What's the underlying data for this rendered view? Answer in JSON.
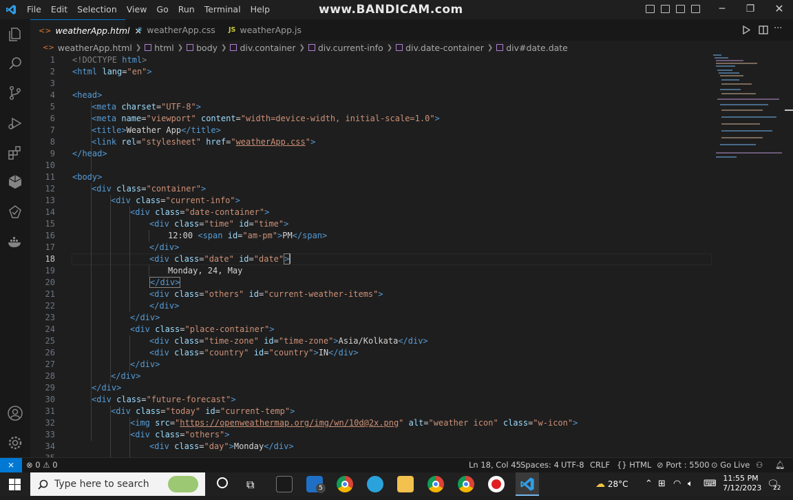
{
  "menu": [
    "File",
    "Edit",
    "Selection",
    "View",
    "Go",
    "Run",
    "Terminal",
    "Help"
  ],
  "watermark": "www.BANDICAM.com",
  "tabs": [
    {
      "icon": "<>",
      "label": "weatherApp.html",
      "close": "×"
    },
    {
      "icon": "#",
      "label": "weatherApp.css"
    },
    {
      "icon": "JS",
      "label": "weatherApp.js"
    }
  ],
  "breadcrumb": [
    "weatherApp.html",
    "html",
    "body",
    "div.container",
    "div.current-info",
    "div.date-container",
    "div#date.date"
  ],
  "line_numbers": [
    "1",
    "2",
    "3",
    "4",
    "5",
    "6",
    "7",
    "8",
    "9",
    "10",
    "11",
    "12",
    "13",
    "14",
    "15",
    "16",
    "17",
    "18",
    "19",
    "20",
    "21",
    "22",
    "23",
    "24",
    "25",
    "26",
    "27",
    "28",
    "29",
    "30",
    "31",
    "32",
    "33",
    "34",
    "35"
  ],
  "code_text": {
    "l1a": "<!DOCTYPE ",
    "l1b": "html",
    "l1c": ">",
    "l2a": "<html ",
    "l2b": "lang",
    "l2c": "=",
    "l2d": "\"en\"",
    "l2e": ">",
    "l4": "<head>",
    "l5a": "<meta ",
    "l5b": "charset",
    "l5c": "=",
    "l5d": "\"UTF-8\"",
    "l5e": ">",
    "l6a": "<meta ",
    "l6b": "name",
    "l6c": "=",
    "l6d": "\"viewport\"",
    "l6e": " content",
    "l6f": "=",
    "l6g": "\"width=device-width, initial-scale=1.0\"",
    "l6h": ">",
    "l7a": "<title>",
    "l7b": "Weather App",
    "l7c": "</title>",
    "l8a": "<link ",
    "l8b": "rel",
    "l8c": "=",
    "l8d": "\"stylesheet\"",
    "l8e": " href",
    "l8f": "=",
    "l8g": "\"",
    "l8h": "weatherApp.css",
    "l8i": "\"",
    "l8j": ">",
    "l9": "</head>",
    "l11": "<body>",
    "l12a": "<div ",
    "l12b": "class",
    "l12c": "=",
    "l12d": "\"container\"",
    "l12e": ">",
    "l13a": "<div ",
    "l13b": "class",
    "l13c": "=",
    "l13d": "\"current-info\"",
    "l13e": ">",
    "l14a": "<div ",
    "l14b": "class",
    "l14c": "=",
    "l14d": "\"date-container\"",
    "l14e": ">",
    "l15a": "<div ",
    "l15b": "class",
    "l15c": "=",
    "l15d": "\"time\"",
    "l15e": " id",
    "l15f": "=",
    "l15g": "\"time\"",
    "l15h": ">",
    "l16a": "12:00 ",
    "l16b": "<span ",
    "l16c": "id",
    "l16d": "=",
    "l16e": "\"am-pm\"",
    "l16f": ">",
    "l16g": "PM",
    "l16h": "</span>",
    "l17": "</div>",
    "l18a": "<div ",
    "l18b": "class",
    "l18c": "=",
    "l18d": "\"date\"",
    "l18e": " id",
    "l18f": "=",
    "l18g": "\"date\"",
    "l18h": ">",
    "l19": "Monday, 24, May",
    "l20": "</div>",
    "l21a": "<div ",
    "l21b": "class",
    "l21c": "=",
    "l21d": "\"others\"",
    "l21e": " id",
    "l21f": "=",
    "l21g": "\"current-weather-items\"",
    "l21h": ">",
    "l22": "</div>",
    "l23": "</div>",
    "l24a": "<div ",
    "l24b": "class",
    "l24c": "=",
    "l24d": "\"place-container\"",
    "l24e": ">",
    "l25a": "<div ",
    "l25b": "class",
    "l25c": "=",
    "l25d": "\"time-zone\"",
    "l25e": " id",
    "l25f": "=",
    "l25g": "\"time-zone\"",
    "l25h": ">",
    "l25i": "Asia/Kolkata",
    "l25j": "</div>",
    "l26a": "<div ",
    "l26b": "class",
    "l26c": "=",
    "l26d": "\"country\"",
    "l26e": " id",
    "l26f": "=",
    "l26g": "\"country\"",
    "l26h": ">",
    "l26i": "IN",
    "l26j": "</div>",
    "l27": "</div>",
    "l28": "</div>",
    "l29": "</div>",
    "l30a": "<div ",
    "l30b": "class",
    "l30c": "=",
    "l30d": "\"future-forecast\"",
    "l30e": ">",
    "l31a": "<div ",
    "l31b": "class",
    "l31c": "=",
    "l31d": "\"today\"",
    "l31e": " id",
    "l31f": "=",
    "l31g": "\"current-temp\"",
    "l31h": ">",
    "l32a": "<img ",
    "l32b": "src",
    "l32c": "=",
    "l32d": "\"",
    "l32e": "https://openweathermap.org/img/wn/10d@2x.png",
    "l32f": "\"",
    "l32g": " alt",
    "l32h": "=",
    "l32i": "\"weather icon\"",
    "l32j": " class",
    "l32k": "=",
    "l32l": "\"w-icon\"",
    "l32m": ">",
    "l33a": "<div ",
    "l33b": "class",
    "l33c": "=",
    "l33d": "\"others\"",
    "l33e": ">",
    "l34a": "<div ",
    "l34b": "class",
    "l34c": "=",
    "l34d": "\"day\"",
    "l34e": ">",
    "l34f": "Monday",
    "l34g": "</div>"
  },
  "status": {
    "errors": "0",
    "warnings": "0",
    "position": "Ln 18, Col 45",
    "spaces": "Spaces: 4",
    "encoding": "UTF-8",
    "eol": "CRLF",
    "language": "HTML",
    "port": "Port : 5500",
    "golive": "Go Live"
  },
  "taskbar": {
    "search_placeholder": "Type here to search",
    "mail_badge": "5",
    "temperature": "28°C",
    "time": "11:55 PM",
    "date": "7/12/2023",
    "notifications": "22"
  }
}
